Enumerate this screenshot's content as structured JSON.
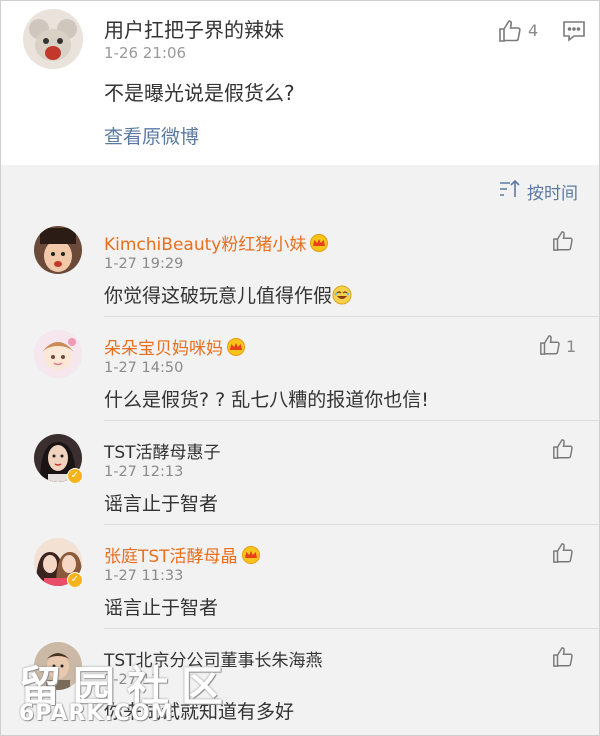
{
  "post": {
    "username": "用户扛把子界的辣妹",
    "time": "1-26 21:06",
    "content": "不是曝光说是假货么?",
    "link_label": "查看原微博",
    "like_count": "4",
    "like_icon": "thumbs-up-icon",
    "more_icon": "comment-box-icon"
  },
  "sort": {
    "label": "按时间",
    "icon": "sort-icon"
  },
  "comments": [
    {
      "username": "KimchiBeauty粉红猪小妹",
      "time": "1-27 19:29",
      "text": "你觉得这破玩意儿值得作假",
      "like_count": "",
      "crown": true,
      "name_color": "#e86f1e",
      "emoji": "laughing-emoji"
    },
    {
      "username": "朵朵宝贝妈咪妈",
      "time": "1-27 14:50",
      "text": "什么是假货? ? 乱七八糟的报道你也信!",
      "like_count": "1",
      "crown": true,
      "name_color": "#e86f1e"
    },
    {
      "username": "TST活酵母惠子",
      "time": "1-27 12:13",
      "text": "谣言止于智者",
      "like_count": "",
      "crown": false,
      "verified": true
    },
    {
      "username": "张庭TST活酵母晶",
      "time": "1-27 11:33",
      "text": "谣言止于智者",
      "like_count": "",
      "crown": true,
      "verified": true,
      "name_color": "#e86f1e"
    },
    {
      "username": "TST北京分公司董事长朱海燕",
      "time": "1-27 11",
      "text": "你来试试就知道有多好",
      "like_count": "",
      "crown": false
    }
  ],
  "watermark": {
    "line1": "留园社区",
    "line2": "6PARK.COM"
  }
}
